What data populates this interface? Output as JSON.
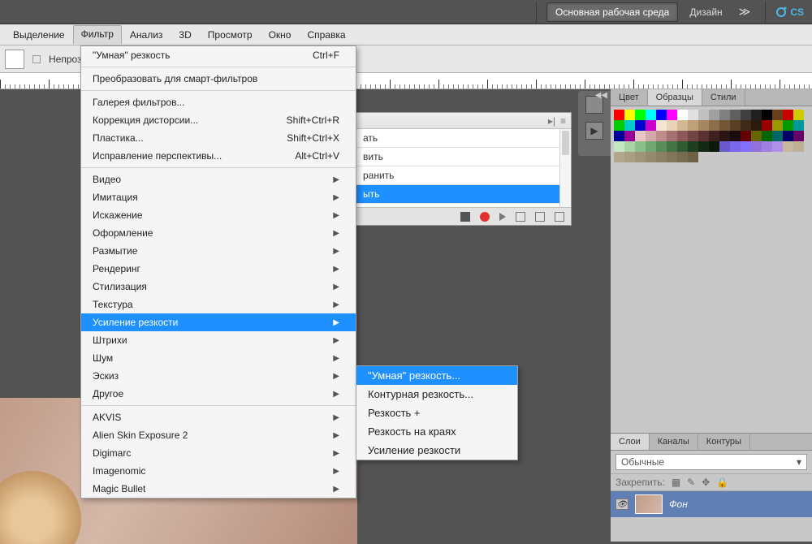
{
  "topbar": {
    "workspace_btn": "Основная рабочая среда",
    "design_txt": "Дизайн",
    "cs_txt": "CS"
  },
  "menubar": {
    "items": [
      "Выделение",
      "Фильтр",
      "Анализ",
      "3D",
      "Просмотр",
      "Окно",
      "Справка"
    ],
    "active_index": 1
  },
  "optbar": {
    "opacity_label": "Непрозрач"
  },
  "filter_menu": {
    "top": [
      {
        "label": "\"Умная\" резкость",
        "shortcut": "Ctrl+F"
      }
    ],
    "convert": {
      "label": "Преобразовать для смарт-фильтров"
    },
    "gallery_group": [
      {
        "label": "Галерея фильтров..."
      },
      {
        "label": "Коррекция дисторсии...",
        "shortcut": "Shift+Ctrl+R"
      },
      {
        "label": "Пластика...",
        "shortcut": "Shift+Ctrl+X"
      },
      {
        "label": "Исправление перспективы...",
        "shortcut": "Alt+Ctrl+V"
      }
    ],
    "sub_groups": [
      "Видео",
      "Имитация",
      "Искажение",
      "Оформление",
      "Размытие",
      "Рендеринг",
      "Стилизация",
      "Текстура",
      "Усиление резкости",
      "Штрихи",
      "Шум",
      "Эскиз",
      "Другое"
    ],
    "highlighted": "Усиление резкости",
    "plugins": [
      "AKVIS",
      "Alien Skin Exposure 2",
      "Digimarc",
      "Imagenomic",
      "Magic Bullet"
    ]
  },
  "submenu": {
    "items": [
      "\"Умная\" резкость...",
      "Контурная резкость...",
      "Резкость +",
      "Резкость на краях",
      "Усиление резкости"
    ],
    "highlighted_index": 0
  },
  "actions_panel": {
    "items": [
      "ать",
      "вить",
      "ранить",
      "ыть"
    ],
    "highlighted_index": 3
  },
  "right_panels": {
    "color_tabs": [
      "Цвет",
      "Образцы",
      "Стили"
    ],
    "color_active": 1,
    "swatch_colors": [
      "#ff0000",
      "#ffff00",
      "#00ff00",
      "#00ffff",
      "#0000ff",
      "#ff00ff",
      "#ffffff",
      "#e0e0e0",
      "#c0c0c0",
      "#a0a0a0",
      "#808080",
      "#606060",
      "#404040",
      "#202020",
      "#000000",
      "#6b3e1a",
      "#cc0000",
      "#cccc00",
      "#00cc00",
      "#00cccc",
      "#0000cc",
      "#cc00cc",
      "#f5e6d3",
      "#e8d4b8",
      "#d4b896",
      "#bfa078",
      "#a68860",
      "#8c6f4a",
      "#735636",
      "#5a3f25",
      "#3e2a17",
      "#2a1b0c",
      "#990000",
      "#999900",
      "#009900",
      "#009999",
      "#000099",
      "#990099",
      "#e8c4c4",
      "#d4a8a8",
      "#bf8c8c",
      "#a67070",
      "#8c5858",
      "#734444",
      "#5a3232",
      "#3e2020",
      "#2a1414",
      "#1a0c0c",
      "#660000",
      "#666600",
      "#006600",
      "#006666",
      "#000066",
      "#660066",
      "#c4e8c4",
      "#a8d4a8",
      "#8cbf8c",
      "#70a670",
      "#588c58",
      "#447344",
      "#325a32",
      "#203e20",
      "#142a14",
      "#0c1a0c",
      "#6a5acd",
      "#7b68ee",
      "#8470ff",
      "#9370db",
      "#a080e0",
      "#b090e8",
      "#c8b8a0",
      "#beb096",
      "#b4a88c",
      "#aa9e82",
      "#a09478",
      "#968a6e",
      "#8c8064",
      "#82765a",
      "#786c50",
      "#6e6246"
    ],
    "layer_tabs": [
      "Слои",
      "Каналы",
      "Контуры"
    ],
    "layer_active": 0,
    "blend_mode": "Обычные",
    "lock_label": "Закрепить:",
    "layer_name": "Фон"
  }
}
